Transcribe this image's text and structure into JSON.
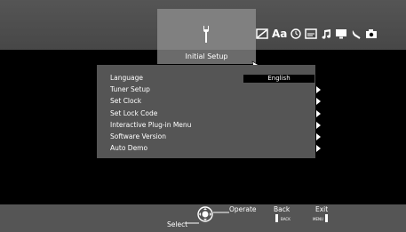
{
  "header": {
    "panel_label": "Initial Setup",
    "icons": [
      "picture-off-icon",
      "text-aa-icon",
      "clock-icon",
      "caption-icon",
      "music-note-icon",
      "monitor-icon",
      "satellite-dish-icon",
      "camera-icon"
    ],
    "aa_text": "Aa"
  },
  "menu": {
    "items": [
      {
        "label": "Language",
        "value": "English",
        "has_arrow": false
      },
      {
        "label": "Tuner Setup",
        "has_arrow": true
      },
      {
        "label": "Set Clock",
        "has_arrow": true
      },
      {
        "label": "Set Lock Code",
        "has_arrow": true
      },
      {
        "label": "Interactive Plug-in Menu",
        "has_arrow": true
      },
      {
        "label": "Software Version",
        "has_arrow": true
      },
      {
        "label": "Auto Demo",
        "has_arrow": true
      }
    ]
  },
  "footer": {
    "select_label": "Select",
    "operate_label": "Operate",
    "back_label": "Back",
    "back_key": "BACK",
    "exit_label": "Exit",
    "exit_key": "MENU"
  }
}
